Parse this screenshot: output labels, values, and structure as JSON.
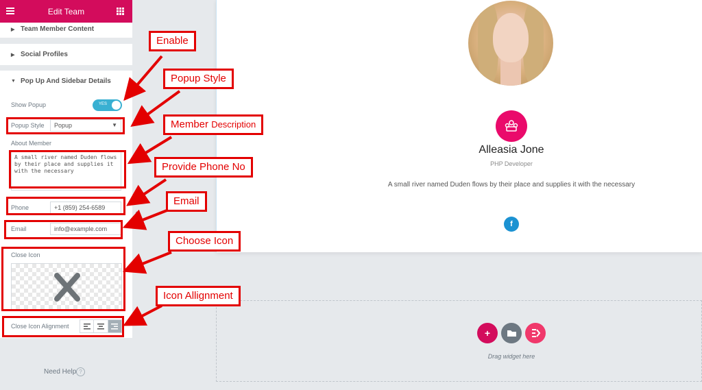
{
  "sidebar": {
    "title": "Edit Team",
    "sections": [
      {
        "label": "Team Member Content"
      },
      {
        "label": "Social Profiles"
      },
      {
        "label": "Pop Up And Sidebar Details"
      }
    ],
    "show_popup": {
      "label": "Show Popup",
      "toggle_text": "YES",
      "enabled": true
    },
    "popup_style": {
      "label": "Popup Style",
      "value": "Popup"
    },
    "about_member": {
      "label": "About Member",
      "value": "A small river named Duden flows by their place and supplies it with the necessary"
    },
    "phone": {
      "label": "Phone",
      "value": "+1 (859) 254-6589"
    },
    "email": {
      "label": "Email",
      "value": "info@example.com"
    },
    "close_icon": {
      "label": "Close Icon",
      "icon": "close-x-icon"
    },
    "close_icon_alignment": {
      "label": "Close Icon Alignment",
      "options": [
        "left",
        "center",
        "right"
      ],
      "selected": "right"
    },
    "need_help": "Need Help",
    "help_symbol": "?"
  },
  "preview": {
    "name": "Alleasia Jone",
    "role": "PHP Developer",
    "description": "A small river named Duden flows by their place and supplies it with the necessary",
    "social_icon": "f",
    "drop_zone_text": "Drag widget here"
  },
  "annotations": {
    "enable": "Enable",
    "popup_style": "Popup Style",
    "member": "Member",
    "description": "Description",
    "phone": "Provide Phone No",
    "email": "Email",
    "choose_icon": "Choose Icon",
    "icon_alignment": "Icon Allignment"
  },
  "colors": {
    "brand": "#d30c5c",
    "accent_pink": "#ea0a6b",
    "toggle_blue": "#39b0d2",
    "facebook": "#1c92d2",
    "annotation_red": "#e30000"
  }
}
